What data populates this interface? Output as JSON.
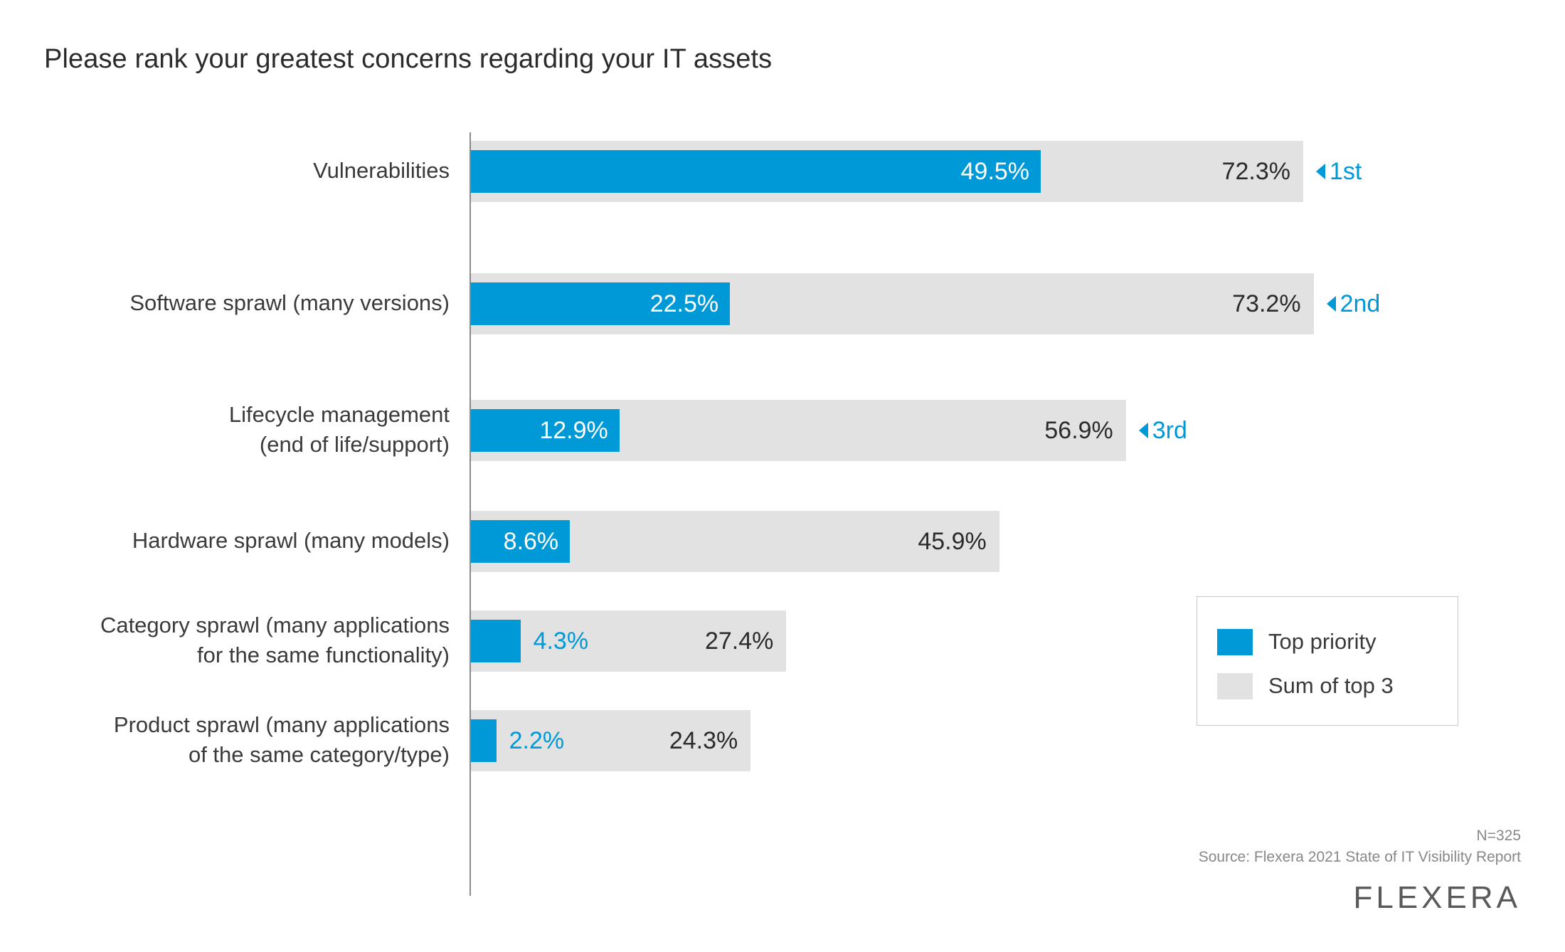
{
  "title": "Please rank your greatest concerns regarding your IT assets",
  "chart_data": {
    "type": "bar",
    "title": "Please rank your greatest concerns regarding your IT assets",
    "xlabel": "",
    "ylabel": "",
    "orientation": "horizontal",
    "xlim": [
      0,
      80
    ],
    "grid": false,
    "legend_position": "right",
    "categories": [
      "Vulnerabilities",
      "Software sprawl (many versions)",
      "Lifecycle management (end of life/support)",
      "Hardware sprawl (many models)",
      "Category sprawl (many applications for the same functionality)",
      "Product sprawl (many applications of the same category/type)"
    ],
    "series": [
      {
        "name": "Top priority",
        "color": "#0099d8",
        "values": [
          49.5,
          22.5,
          12.9,
          8.6,
          4.3,
          2.2
        ]
      },
      {
        "name": "Sum of top 3",
        "color": "#e2e2e2",
        "values": [
          72.3,
          73.2,
          56.9,
          45.9,
          27.4,
          24.3
        ]
      }
    ],
    "annotations": [
      "1st",
      "2nd",
      "3rd"
    ],
    "note": "N=325",
    "source": "Source: Flexera 2021 State of IT Visibility Report"
  },
  "rows": [
    {
      "label_line1": "Vulnerabilities",
      "label_line2": "",
      "blue_value": 49.5,
      "blue_label": "49.5%",
      "gray_value": 72.3,
      "gray_label": "72.3%",
      "rank": "1st",
      "blue_label_inside": true
    },
    {
      "label_line1": "Software sprawl (many versions)",
      "label_line2": "",
      "blue_value": 22.5,
      "blue_label": "22.5%",
      "gray_value": 73.2,
      "gray_label": "73.2%",
      "rank": "2nd",
      "blue_label_inside": true
    },
    {
      "label_line1": "Lifecycle management",
      "label_line2": "(end of life/support)",
      "blue_value": 12.9,
      "blue_label": "12.9%",
      "gray_value": 56.9,
      "gray_label": "56.9%",
      "rank": "3rd",
      "blue_label_inside": true
    },
    {
      "label_line1": "Hardware sprawl (many models)",
      "label_line2": "",
      "blue_value": 8.6,
      "blue_label": "8.6%",
      "gray_value": 45.9,
      "gray_label": "45.9%",
      "rank": "",
      "blue_label_inside": true
    },
    {
      "label_line1": "Category sprawl (many applications",
      "label_line2": "for the same functionality)",
      "blue_value": 4.3,
      "blue_label": "4.3%",
      "gray_value": 27.4,
      "gray_label": "27.4%",
      "rank": "",
      "blue_label_inside": false
    },
    {
      "label_line1": "Product sprawl (many applications",
      "label_line2": "of the same category/type)",
      "blue_value": 2.2,
      "blue_label": "2.2%",
      "gray_value": 24.3,
      "gray_label": "24.3%",
      "rank": "",
      "blue_label_inside": false
    }
  ],
  "legend": {
    "items": [
      {
        "label": "Top priority",
        "color": "#0099d8"
      },
      {
        "label": "Sum of top 3",
        "color": "#e2e2e2"
      }
    ]
  },
  "footer": {
    "n": "N=325",
    "source": "Source: Flexera 2021 State of IT Visibility Report",
    "logo": "FLEXERA"
  },
  "colors": {
    "accent": "#0099d8",
    "bar_gray": "#e2e2e2",
    "text": "#2b2b2b",
    "muted": "#888888"
  }
}
